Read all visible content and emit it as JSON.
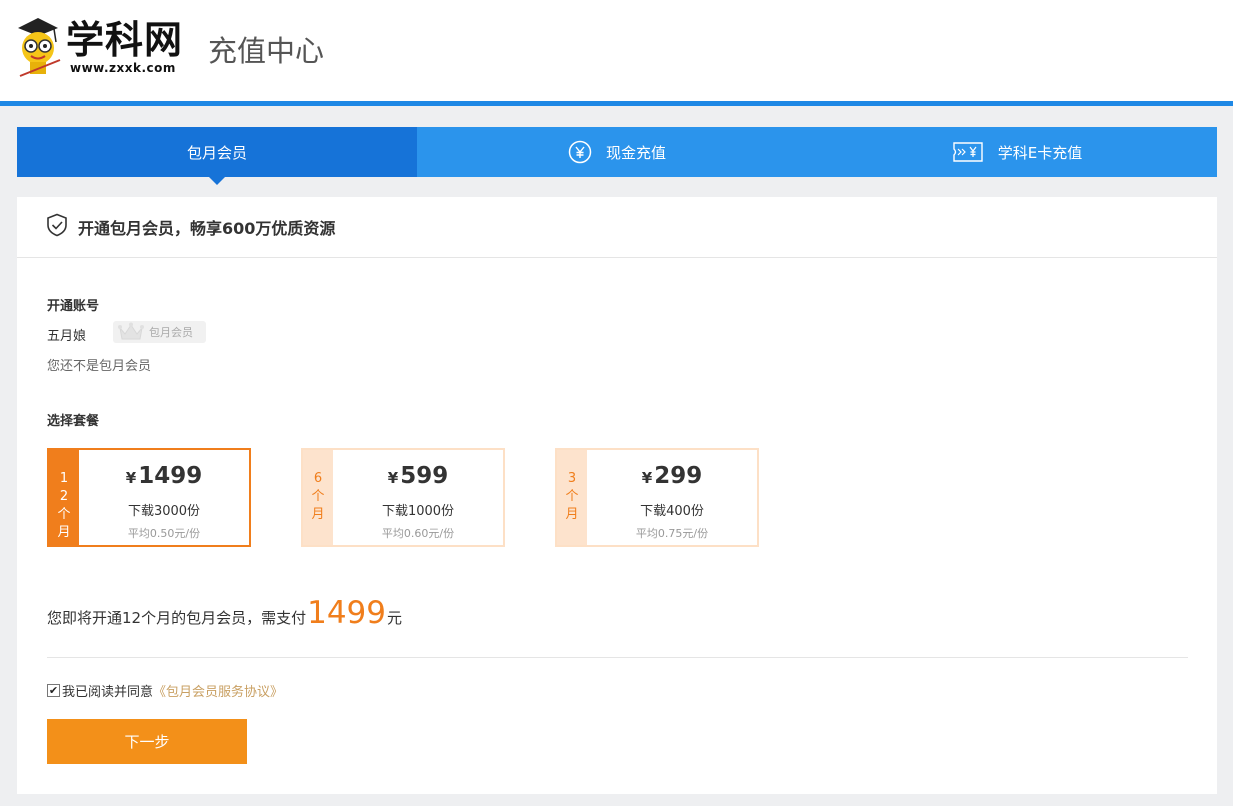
{
  "header": {
    "logo_text": "学科网",
    "logo_url_text": "www.zxxk.com",
    "page_title": "充值中心"
  },
  "tabs": [
    {
      "label": "包月会员",
      "icon": "none",
      "active": true
    },
    {
      "label": "现金充值",
      "icon": "yen-circle-icon",
      "active": false
    },
    {
      "label": "学科E卡充值",
      "icon": "card-icon",
      "active": false
    }
  ],
  "panel": {
    "heading": "开通包月会员，畅享600万优质资源",
    "account_label": "开通账号",
    "account_name": "五月娘",
    "badge_text": "包月会员",
    "status_text": "您还不是包月会员",
    "plan_label": "选择套餐"
  },
  "plans": [
    {
      "duration": "12个月",
      "currency": "¥",
      "price": "1499",
      "downloads": "下载3000份",
      "average": "平均0.50元/份",
      "selected": true
    },
    {
      "duration": "6个月",
      "currency": "¥",
      "price": "599",
      "downloads": "下载1000份",
      "average": "平均0.60元/份",
      "selected": false
    },
    {
      "duration": "3个月",
      "currency": "¥",
      "price": "299",
      "downloads": "下载400份",
      "average": "平均0.75元/份",
      "selected": false
    }
  ],
  "summary": {
    "prefix": "您即将开通12个月的包月会员，需支付",
    "amount": "1499",
    "suffix": "元"
  },
  "agreement": {
    "checked": true,
    "text": "我已阅读并同意",
    "link_text": "《包月会员服务协议》"
  },
  "next_button": "下一步",
  "colors": {
    "primary_blue": "#2b94ec",
    "active_tab_blue": "#1673d8",
    "accent_orange": "#f07e1c",
    "button_orange": "#f39019"
  }
}
